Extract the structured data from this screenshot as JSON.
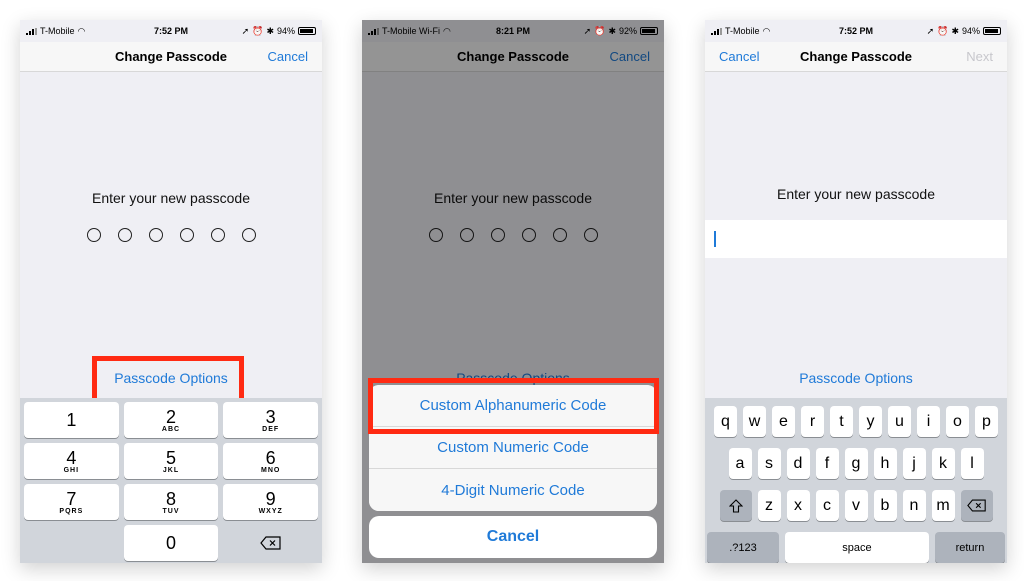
{
  "panel1": {
    "status": {
      "carrier": "T-Mobile",
      "time": "7:52 PM",
      "battery": "94%"
    },
    "nav": {
      "title": "Change Passcode",
      "right": "Cancel"
    },
    "prompt": "Enter your new passcode",
    "options_link": "Passcode Options",
    "keypad": [
      [
        {
          "digit": "1",
          "letters": ""
        },
        {
          "digit": "2",
          "letters": "ABC"
        },
        {
          "digit": "3",
          "letters": "DEF"
        }
      ],
      [
        {
          "digit": "4",
          "letters": "GHI"
        },
        {
          "digit": "5",
          "letters": "JKL"
        },
        {
          "digit": "6",
          "letters": "MNO"
        }
      ],
      [
        {
          "digit": "7",
          "letters": "PQRS"
        },
        {
          "digit": "8",
          "letters": "TUV"
        },
        {
          "digit": "9",
          "letters": "WXYZ"
        }
      ],
      [
        {
          "digit": "0",
          "letters": ""
        }
      ]
    ]
  },
  "panel2": {
    "status": {
      "carrier": "T-Mobile Wi-Fi",
      "time": "8:21 PM",
      "battery": "92%"
    },
    "nav": {
      "title": "Change Passcode",
      "right": "Cancel"
    },
    "prompt": "Enter your new passcode",
    "options_link": "Passcode Options",
    "sheet": {
      "items": [
        "Custom Alphanumeric Code",
        "Custom Numeric Code",
        "4-Digit Numeric Code"
      ],
      "cancel": "Cancel"
    }
  },
  "panel3": {
    "status": {
      "carrier": "T-Mobile",
      "time": "7:52 PM",
      "battery": "94%"
    },
    "nav": {
      "left": "Cancel",
      "title": "Change Passcode",
      "right": "Next"
    },
    "prompt": "Enter your new passcode",
    "options_link": "Passcode Options",
    "keyboard": {
      "row1": [
        "q",
        "w",
        "e",
        "r",
        "t",
        "y",
        "u",
        "i",
        "o",
        "p"
      ],
      "row2": [
        "a",
        "s",
        "d",
        "f",
        "g",
        "h",
        "j",
        "k",
        "l"
      ],
      "row3": [
        "z",
        "x",
        "c",
        "v",
        "b",
        "n",
        "m"
      ],
      "numbers_key": ".?123",
      "space_key": "space",
      "return_key": "return"
    }
  },
  "colors": {
    "accent": "#1f7ad8",
    "highlight": "#ff2a12"
  }
}
